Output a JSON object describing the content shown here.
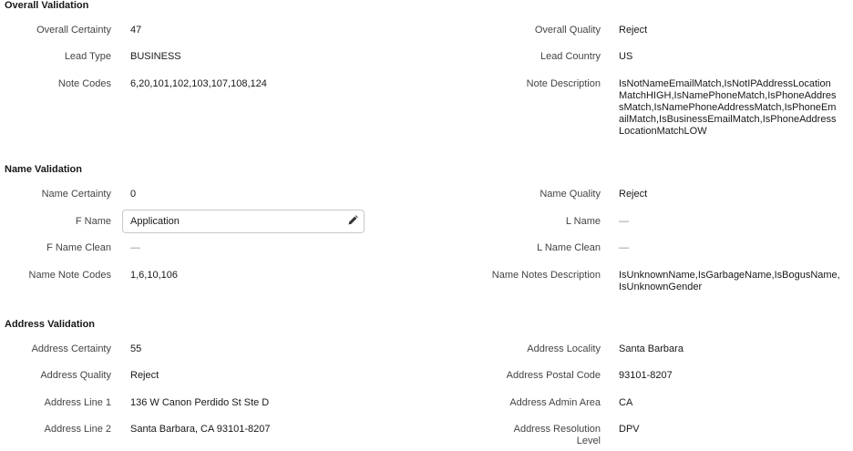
{
  "overall": {
    "title": "Overall Validation",
    "certainty_label": "Overall Certainty",
    "certainty": "47",
    "quality_label": "Overall Quality",
    "quality": "Reject",
    "lead_type_label": "Lead Type",
    "lead_type": "BUSINESS",
    "lead_country_label": "Lead Country",
    "lead_country": "US",
    "note_codes_label": "Note Codes",
    "note_codes": "6,20,101,102,103,107,108,124",
    "note_desc_label": "Note Description",
    "note_desc": "IsNotNameEmailMatch,IsNotIPAddressLocationMatchHIGH,IsNamePhoneMatch,IsPhoneAddressMatch,IsNamePhoneAddressMatch,IsPhoneEmailMatch,IsBusinessEmailMatch,IsPhoneAddressLocationMatchLOW"
  },
  "name": {
    "title": "Name Validation",
    "certainty_label": "Name Certainty",
    "certainty": "0",
    "quality_label": "Name Quality",
    "quality": "Reject",
    "fname_label": "F Name",
    "fname": "Application",
    "lname_label": "L Name",
    "lname": "—",
    "fname_clean_label": "F Name Clean",
    "fname_clean": "—",
    "lname_clean_label": "L Name Clean",
    "lname_clean": "—",
    "note_codes_label": "Name Note Codes",
    "note_codes": "1,6,10,106",
    "notes_desc_label": "Name Notes Description",
    "notes_desc": "IsUnknownName,IsGarbageName,IsBogusName, IsUnknownGender"
  },
  "address": {
    "title": "Address Validation",
    "certainty_label": "Address Certainty",
    "certainty": "55",
    "locality_label": "Address Locality",
    "locality": "Santa Barbara",
    "quality_label": "Address Quality",
    "quality": "Reject",
    "postal_label": "Address Postal Code",
    "postal": "93101-8207",
    "line1_label": "Address Line 1",
    "line1": "136 W Canon Perdido St Ste D",
    "admin_label": "Address Admin Area",
    "admin": "CA",
    "line2_label": "Address Line 2",
    "line2": "Santa Barbara, CA 93101-8207",
    "resolution_label": "Address Resolution Level",
    "resolution": "DPV"
  }
}
